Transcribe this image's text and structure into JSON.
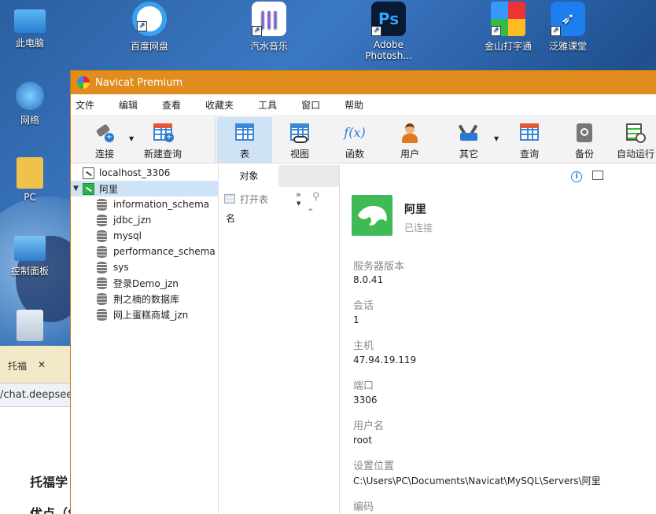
{
  "desktop": {
    "icons": [
      {
        "label": "此电脑",
        "shortcut": false
      },
      {
        "label": "百度网盘",
        "shortcut": true
      },
      {
        "label": "汽水音乐",
        "shortcut": true
      },
      {
        "label": "Adobe Photosh...",
        "shortcut": true
      },
      {
        "label": "金山打字通",
        "shortcut": true
      },
      {
        "label": "泛雅课堂",
        "shortcut": true
      },
      {
        "label": "网络",
        "shortcut": false
      },
      {
        "label": "PC",
        "shortcut": false
      },
      {
        "label": "控制面板",
        "shortcut": false
      }
    ],
    "ps_logo_text": "Ps"
  },
  "bg_browser": {
    "tab_text": "托福",
    "url_text": "/chat.deepseek",
    "body_text1": "托福学",
    "body_text2": "优点（S"
  },
  "window": {
    "title": "Navicat Premium",
    "menu": [
      "文件",
      "编辑",
      "查看",
      "收藏夹",
      "工具",
      "窗口",
      "帮助"
    ],
    "toolbar": {
      "connect": "连接",
      "new_query": "新建查询",
      "table": "表",
      "view": "视图",
      "function": "函数",
      "user": "用户",
      "other": "其它",
      "query": "查询",
      "backup": "备份",
      "automation": "自动运行",
      "function_icon_text": "f(x)"
    },
    "tree": {
      "connections": [
        {
          "name": "localhost_3306",
          "open": false
        },
        {
          "name": "阿里",
          "open": true
        }
      ],
      "databases": [
        "information_schema",
        "jdbc_jzn",
        "mysql",
        "performance_schema",
        "sys",
        "登录Demo_jzn",
        "荆之楠的数据库",
        "网上蛋糕商城_jzn"
      ]
    },
    "objects": {
      "tab": "对象",
      "open_table": "打开表",
      "column_name": "名"
    },
    "info": {
      "name": "阿里",
      "status": "已连接",
      "fields": [
        {
          "label": "服务器版本",
          "value": "8.0.41"
        },
        {
          "label": "会话",
          "value": "1"
        },
        {
          "label": "主机",
          "value": "47.94.19.119"
        },
        {
          "label": "端口",
          "value": "3306"
        },
        {
          "label": "用户名",
          "value": "root"
        },
        {
          "label": "设置位置",
          "value": "C:\\Users\\PC\\Documents\\Navicat\\MySQL\\Servers\\阿里"
        },
        {
          "label": "编码",
          "value": ""
        }
      ]
    }
  }
}
